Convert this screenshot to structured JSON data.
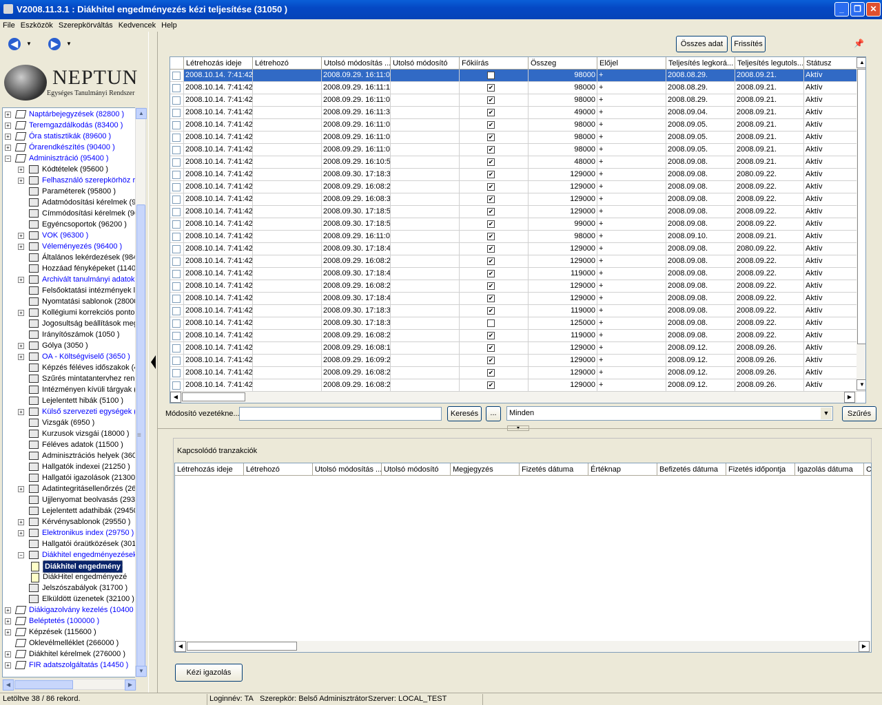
{
  "window": {
    "title": "V2008.11.3.1 : Diákhitel engedményezés kézi teljesítése (31050  )",
    "min": "_",
    "max": "❐",
    "close": "✕"
  },
  "menu": [
    "File",
    "Eszközök",
    "Szerepkörváltás",
    "Kedvencek",
    "Help"
  ],
  "nav": {
    "back": "◀",
    "forward": "▶",
    "dropdown": "▼"
  },
  "logo": {
    "name": "NEPTUN",
    "subtitle": "Egységes Tanulmányi Rendszer"
  },
  "tree": [
    {
      "label": "Naptárbejegyzések (82800  )",
      "level": 0,
      "expand": "+",
      "icon": "book",
      "link": true
    },
    {
      "label": "Teremgazdálkodás (83400  )",
      "level": 0,
      "expand": "+",
      "icon": "book",
      "link": true
    },
    {
      "label": "Óra statisztikák (89600  )",
      "level": 0,
      "expand": "+",
      "icon": "book",
      "link": true
    },
    {
      "label": "Órarendkészítés (90400  )",
      "level": 0,
      "expand": "+",
      "icon": "book",
      "link": true
    },
    {
      "label": "Adminisztráció (95400  )",
      "level": 0,
      "expand": "−",
      "icon": "book",
      "link": true
    },
    {
      "label": "Kódtételek (95600  )",
      "level": 1,
      "expand": "+",
      "icon": "folder",
      "link": false
    },
    {
      "label": "Felhasználó szerepkörhöz re",
      "level": 1,
      "expand": "+",
      "icon": "folder",
      "link": true
    },
    {
      "label": "Paraméterek (95800  )",
      "level": 1,
      "expand": "",
      "icon": "folder",
      "link": false
    },
    {
      "label": "Adatmódosítási kérelmek (96",
      "level": 1,
      "expand": "",
      "icon": "folder",
      "link": false
    },
    {
      "label": "Címmódosítási kérelmek (96",
      "level": 1,
      "expand": "",
      "icon": "folder",
      "link": false
    },
    {
      "label": "Egyéncsoportok (96200  )",
      "level": 1,
      "expand": "",
      "icon": "folder",
      "link": false
    },
    {
      "label": "VOK (96300  )",
      "level": 1,
      "expand": "+",
      "icon": "folder",
      "link": true
    },
    {
      "label": "Véleményezés (96400  )",
      "level": 1,
      "expand": "+",
      "icon": "folder",
      "link": true
    },
    {
      "label": "Általános lekérdezések (984",
      "level": 1,
      "expand": "",
      "icon": "folder",
      "link": false
    },
    {
      "label": "Hozzáad fényképeket (1140",
      "level": 1,
      "expand": "",
      "icon": "folder",
      "link": false
    },
    {
      "label": "Archivált tanulmányi adatok (",
      "level": 1,
      "expand": "+",
      "icon": "folder",
      "link": true
    },
    {
      "label": "Felsőoktatási intézmények lis",
      "level": 1,
      "expand": "",
      "icon": "folder",
      "link": false
    },
    {
      "label": "Nyomtatási sablonok (28000",
      "level": 1,
      "expand": "",
      "icon": "folder",
      "link": false
    },
    {
      "label": "Kollégiumi korrekciós pontok",
      "level": 1,
      "expand": "+",
      "icon": "folder",
      "link": false
    },
    {
      "label": "Jogosultság beállítások meg",
      "level": 1,
      "expand": "",
      "icon": "folder",
      "link": false
    },
    {
      "label": "Irányítószámok (1050  )",
      "level": 1,
      "expand": "",
      "icon": "folder",
      "link": false
    },
    {
      "label": "Gólya (3050  )",
      "level": 1,
      "expand": "+",
      "icon": "folder",
      "link": false
    },
    {
      "label": "OA - Költségviselő (3650  )",
      "level": 1,
      "expand": "+",
      "icon": "folder",
      "link": true
    },
    {
      "label": "Képzés féléves időszakok (4",
      "level": 1,
      "expand": "",
      "icon": "folder",
      "link": false
    },
    {
      "label": "Szűrés mintatantervhez rend",
      "level": 1,
      "expand": "",
      "icon": "folder",
      "link": false
    },
    {
      "label": "Intézményen kívüli tárgyak (4",
      "level": 1,
      "expand": "",
      "icon": "folder",
      "link": false
    },
    {
      "label": "Lejelentett hibák (5100  )",
      "level": 1,
      "expand": "",
      "icon": "folder",
      "link": false
    },
    {
      "label": "Külső szervezeti egységek (67",
      "level": 1,
      "expand": "+",
      "icon": "folder",
      "link": true
    },
    {
      "label": "Vizsgák (6950  )",
      "level": 1,
      "expand": "",
      "icon": "folder",
      "link": false
    },
    {
      "label": "Kurzusok vizsgái (18000  )",
      "level": 1,
      "expand": "",
      "icon": "folder",
      "link": false
    },
    {
      "label": "Féléves adatok (11500  )",
      "level": 1,
      "expand": "",
      "icon": "folder",
      "link": false
    },
    {
      "label": "Adminisztrációs helyek (3600",
      "level": 1,
      "expand": "",
      "icon": "folder",
      "link": false
    },
    {
      "label": "Hallgatók indexei (21250  )",
      "level": 1,
      "expand": "",
      "icon": "folder",
      "link": false
    },
    {
      "label": "Hallgatói igazolások (21300",
      "level": 1,
      "expand": "",
      "icon": "folder",
      "link": false
    },
    {
      "label": "Adatintegritásellenőrzés (268",
      "level": 1,
      "expand": "+",
      "icon": "folder",
      "link": false
    },
    {
      "label": "Ujjlenyomat beolvasás (2930",
      "level": 1,
      "expand": "",
      "icon": "folder",
      "link": false
    },
    {
      "label": "Lejelentett adathibák (29450",
      "level": 1,
      "expand": "",
      "icon": "folder",
      "link": false
    },
    {
      "label": "Kérvénysablonok (29550  )",
      "level": 1,
      "expand": "+",
      "icon": "folder",
      "link": false
    },
    {
      "label": "Elektronikus index (29750  )",
      "level": 1,
      "expand": "+",
      "icon": "folder",
      "link": true
    },
    {
      "label": "Hallgatói óraütközések (3010",
      "level": 1,
      "expand": "",
      "icon": "folder",
      "link": false
    },
    {
      "label": "Diákhitel engedményezések",
      "level": 1,
      "expand": "−",
      "icon": "folder",
      "link": true
    },
    {
      "label": "Diákhitel engedmény",
      "level": 2,
      "expand": "",
      "icon": "doc",
      "link": false,
      "selected": true
    },
    {
      "label": "DiákHitel engedményezé",
      "level": 2,
      "expand": "",
      "icon": "doc",
      "link": false
    },
    {
      "label": "Jelszószabályok (31700  )",
      "level": 1,
      "expand": "",
      "icon": "folder",
      "link": false
    },
    {
      "label": "Elküldött üzenetek (32100  )",
      "level": 1,
      "expand": "",
      "icon": "folder",
      "link": false
    },
    {
      "label": "Diákigazolvány kezelés (10400",
      "level": 0,
      "expand": "+",
      "icon": "book",
      "link": true
    },
    {
      "label": "Beléptetés (100000  )",
      "level": 0,
      "expand": "+",
      "icon": "book",
      "link": true
    },
    {
      "label": "Képzések (115600  )",
      "level": 0,
      "expand": "+",
      "icon": "book",
      "link": false
    },
    {
      "label": "Oklevélmelléklet (266000  )",
      "level": 0,
      "expand": "",
      "icon": "book",
      "link": false
    },
    {
      "label": "Diákhitel kérelmek (276000  )",
      "level": 0,
      "expand": "+",
      "icon": "book",
      "link": false
    },
    {
      "label": "FIR adatszolgáltatás (14450  )",
      "level": 0,
      "expand": "+",
      "icon": "book",
      "link": true
    }
  ],
  "toolbar": {
    "all_data": "Összes adat",
    "refresh": "Frissítés",
    "pin": "📌"
  },
  "grid": {
    "columns": [
      "Létrehozás ideje",
      "Létrehozó",
      "Utolsó módosítás ...",
      "Utolsó módosító",
      "Főkiírás",
      "Összeg",
      "Előjel",
      "Teljesítés legkorá...",
      "Teljesítés legutols...",
      "Státusz"
    ],
    "rows": [
      [
        "2008.10.14. 7:41:42",
        "",
        "2008.09.29. 16:11:0",
        "",
        true,
        "98000",
        "+",
        "2008.08.29.",
        "2008.09.21.",
        "Aktív"
      ],
      [
        "2008.10.14. 7:41:42",
        "",
        "2008.09.29. 16:11:1",
        "",
        true,
        "98000",
        "+",
        "2008.08.29.",
        "2008.09.21.",
        "Aktív"
      ],
      [
        "2008.10.14. 7:41:42",
        "",
        "2008.09.29. 16:11:0",
        "",
        true,
        "98000",
        "+",
        "2008.08.29.",
        "2008.09.21.",
        "Aktív"
      ],
      [
        "2008.10.14. 7:41:42",
        "",
        "2008.09.29. 16:11:3",
        "",
        true,
        "49000",
        "+",
        "2008.09.04.",
        "2008.09.21.",
        "Aktív"
      ],
      [
        "2008.10.14. 7:41:42",
        "",
        "2008.09.29. 16:11:0",
        "",
        true,
        "98000",
        "+",
        "2008.09.05.",
        "2008.09.21.",
        "Aktív"
      ],
      [
        "2008.10.14. 7:41:42",
        "",
        "2008.09.29. 16:11:0",
        "",
        true,
        "98000",
        "+",
        "2008.09.05.",
        "2008.09.21.",
        "Aktív"
      ],
      [
        "2008.10.14. 7:41:42",
        "",
        "2008.09.29. 16:11:0",
        "",
        true,
        "98000",
        "+",
        "2008.09.05.",
        "2008.09.21.",
        "Aktív"
      ],
      [
        "2008.10.14. 7:41:42",
        "",
        "2008.09.29. 16:10:5",
        "",
        true,
        "48000",
        "+",
        "2008.09.08.",
        "2008.09.21.",
        "Aktív"
      ],
      [
        "2008.10.14. 7:41:42",
        "",
        "2008.09.30. 17:18:3",
        "",
        true,
        "129000",
        "+",
        "2008.09.08.",
        "2080.09.22.",
        "Aktív"
      ],
      [
        "2008.10.14. 7:41:42",
        "",
        "2008.09.29. 16:08:2",
        "",
        true,
        "129000",
        "+",
        "2008.09.08.",
        "2008.09.22.",
        "Aktív"
      ],
      [
        "2008.10.14. 7:41:42",
        "",
        "2008.09.29. 16:08:3",
        "",
        true,
        "129000",
        "+",
        "2008.09.08.",
        "2008.09.22.",
        "Aktív"
      ],
      [
        "2008.10.14. 7:41:42",
        "",
        "2008.09.30. 17:18:5",
        "",
        true,
        "129000",
        "+",
        "2008.09.08.",
        "2008.09.22.",
        "Aktív"
      ],
      [
        "2008.10.14. 7:41:42",
        "",
        "2008.09.30. 17:18:5",
        "",
        true,
        "99000",
        "+",
        "2008.09.08.",
        "2008.09.22.",
        "Aktív"
      ],
      [
        "2008.10.14. 7:41:42",
        "",
        "2008.09.29. 16:11:0",
        "",
        true,
        "98000",
        "+",
        "2008.09.10.",
        "2008.09.21.",
        "Aktív"
      ],
      [
        "2008.10.14. 7:41:42",
        "",
        "2008.09.30. 17:18:4",
        "",
        true,
        "129000",
        "+",
        "2008.09.08.",
        "2080.09.22.",
        "Aktív"
      ],
      [
        "2008.10.14. 7:41:42",
        "",
        "2008.09.29. 16:08:2",
        "",
        true,
        "129000",
        "+",
        "2008.09.08.",
        "2008.09.22.",
        "Aktív"
      ],
      [
        "2008.10.14. 7:41:42",
        "",
        "2008.09.30. 17:18:4",
        "",
        true,
        "119000",
        "+",
        "2008.09.08.",
        "2008.09.22.",
        "Aktív"
      ],
      [
        "2008.10.14. 7:41:42",
        "",
        "2008.09.29. 16:08:2",
        "",
        true,
        "129000",
        "+",
        "2008.09.08.",
        "2008.09.22.",
        "Aktív"
      ],
      [
        "2008.10.14. 7:41:42",
        "",
        "2008.09.30. 17:18:4",
        "",
        true,
        "129000",
        "+",
        "2008.09.08.",
        "2008.09.22.",
        "Aktív"
      ],
      [
        "2008.10.14. 7:41:42",
        "",
        "2008.09.30. 17:18:3",
        "",
        true,
        "119000",
        "+",
        "2008.09.08.",
        "2008.09.22.",
        "Aktív"
      ],
      [
        "2008.10.14. 7:41:42",
        "",
        "2008.09.30. 17:18:3",
        "",
        false,
        "125000",
        "+",
        "2008.09.08.",
        "2008.09.22.",
        "Aktív"
      ],
      [
        "2008.10.14. 7:41:42",
        "",
        "2008.09.29. 16:08:2",
        "",
        true,
        "119000",
        "+",
        "2008.09.08.",
        "2008.09.22.",
        "Aktív"
      ],
      [
        "2008.10.14. 7:41:42",
        "",
        "2008.09.29. 16:08:1",
        "",
        true,
        "129000",
        "+",
        "2008.09.12.",
        "2008.09.26.",
        "Aktív"
      ],
      [
        "2008.10.14. 7:41:42",
        "",
        "2008.09.29. 16:09:2",
        "",
        true,
        "129000",
        "+",
        "2008.09.12.",
        "2008.09.26.",
        "Aktív"
      ],
      [
        "2008.10.14. 7:41:42",
        "",
        "2008.09.29. 16:08:2",
        "",
        true,
        "129000",
        "+",
        "2008.09.12.",
        "2008.09.26.",
        "Aktív"
      ],
      [
        "2008.10.14. 7:41:42",
        "",
        "2008.09.29. 16:08:2",
        "",
        true,
        "129000",
        "+",
        "2008.09.12.",
        "2008.09.26.",
        "Aktív"
      ]
    ]
  },
  "filter": {
    "label": "Módosító vezetékne...",
    "search_value": "",
    "search_btn": "Keresés",
    "ellipsis_btn": "...",
    "combo_value": "Minden",
    "combo_arrow": "▼",
    "filter_btn": "Szűrés"
  },
  "related": {
    "title": "Kapcsolódó tranzakciók",
    "columns": [
      "Létrehozás ideje",
      "Létrehozó",
      "Utolsó módosítás ...",
      "Utolsó módosító",
      "Megjegyzés",
      "Fizetés dátuma",
      "Értéknap",
      "Befizetés dátuma",
      "Fizetés időpontja",
      "Igazolás dátuma",
      "C"
    ]
  },
  "bottom": {
    "manual_btn": "Kézi igazolás"
  },
  "status": {
    "records": "Letöltve 38 / 86 rekord.",
    "login": "Loginnév: TA",
    "role": "Szerepkör: Belső Adminisztrátor",
    "server": "Szerver: LOCAL_TEST"
  },
  "scroll": {
    "up": "▲",
    "down": "▼",
    "left": "◀",
    "right": "▶",
    "collapse": "◀",
    "grip": "≡",
    "splitter_grip": "▾"
  }
}
